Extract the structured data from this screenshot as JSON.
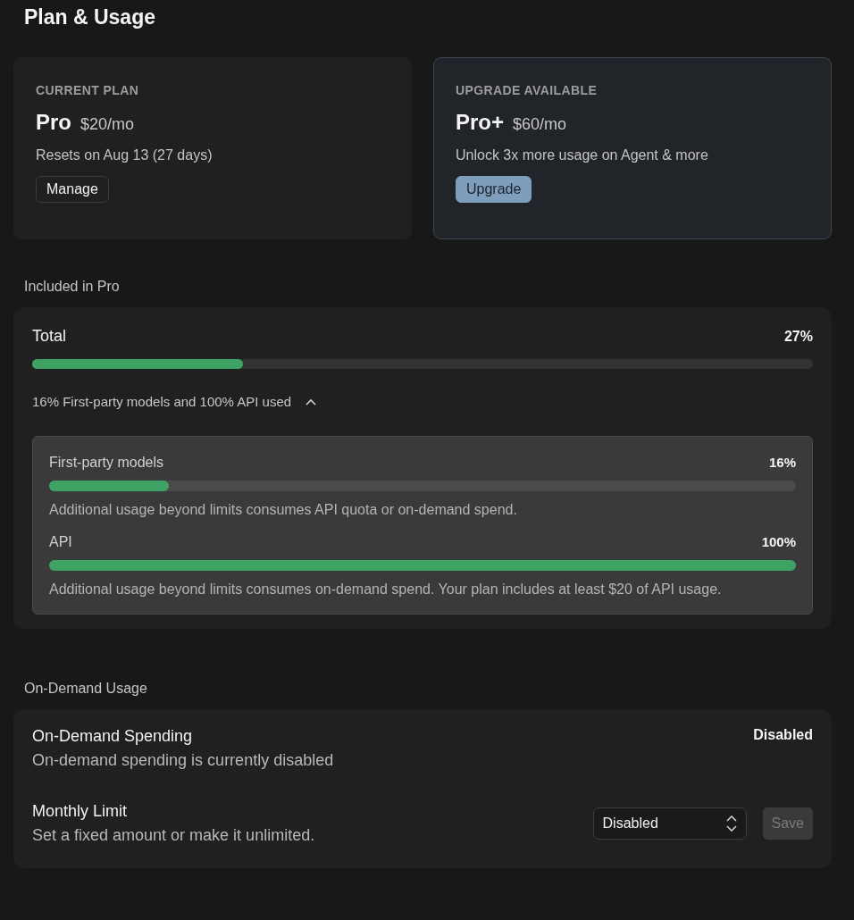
{
  "title": "Plan & Usage",
  "plans": [
    {
      "kind": "current",
      "eyebrow": "CURRENT PLAN",
      "name": "Pro",
      "price": "$20/mo",
      "note": "Resets on Aug 13 (27 days)",
      "button": "Manage"
    },
    {
      "kind": "upgrade",
      "eyebrow": "UPGRADE AVAILABLE",
      "name": "Pro+",
      "price": "$60/mo",
      "note": "Unlock 3x more usage on Agent & more",
      "button": "Upgrade"
    }
  ],
  "included": {
    "heading": "Included in Pro",
    "total": {
      "label": "Total",
      "reading": "27%",
      "level": 0.27
    },
    "summary": "16% First-party models and 100% API used",
    "expanded": true,
    "meters": [
      {
        "label": "First-party models",
        "reading": "16%",
        "level": 0.16,
        "note": "Additional usage beyond limits consumes API quota or on-demand spend."
      },
      {
        "label": "API",
        "reading": "100%",
        "level": 1.0,
        "note": "Additional usage beyond limits consumes on-demand spend. Your plan includes at least $20 of API usage."
      }
    ]
  },
  "on_demand": {
    "heading": "On-Demand Usage",
    "spending": {
      "title": "On-Demand Spending",
      "description": "On-demand spending is currently disabled",
      "status": "Disabled"
    },
    "limit": {
      "title": "Monthly Limit",
      "description": "Set a fixed amount or make it unlimited.",
      "select_value": "Disabled",
      "save": {
        "label": "Save",
        "disabled": true
      }
    }
  }
}
